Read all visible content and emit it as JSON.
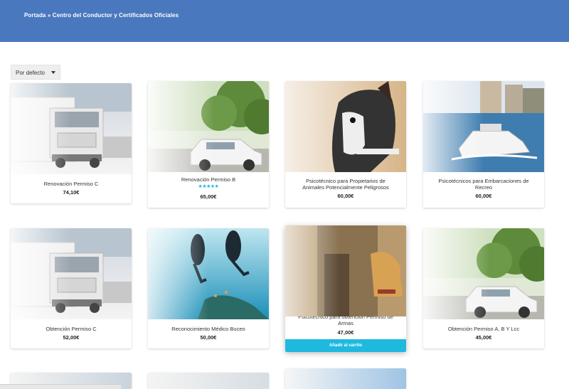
{
  "breadcrumb": {
    "home": "Portada",
    "separator": " » ",
    "current": "Centro del Conductor y Certificados Oficiales"
  },
  "sort": {
    "selected": "Por defecto"
  },
  "colors": {
    "header": "#4a78be",
    "accent": "#1fb9e0",
    "stars": "#1fb5e8"
  },
  "products": [
    {
      "title": "Renovación Permiso C",
      "price": "74,10€",
      "image": "truck-photo"
    },
    {
      "title": "Renovación Permiso B",
      "price": "65,00€",
      "image": "car-photo",
      "stars": "★★★★★"
    },
    {
      "title": "Psicotécnico para Propietarios de Animales Potencialmente Peligrosos",
      "price": "60,00€",
      "image": "dog-photo"
    },
    {
      "title": "Psicotécnicos para Embarcaciones de Recreo",
      "price": "60,00€",
      "image": "boat-photo"
    },
    {
      "title": "Obtención Permiso C",
      "price": "52,00€",
      "image": "truck-photo"
    },
    {
      "title": "Reconocimiento Médico Buceo",
      "price": "50,00€",
      "image": "diver-photo"
    },
    {
      "title": "Psicotécnico para obtención Permiso de Armas",
      "price": "47,00€",
      "image": "hunter-photo",
      "add_to_cart": "Añadir al carrito"
    },
    {
      "title": "Obtención Permiso A, B Y Lcc",
      "price": "45,00€",
      "image": "car-photo"
    }
  ]
}
